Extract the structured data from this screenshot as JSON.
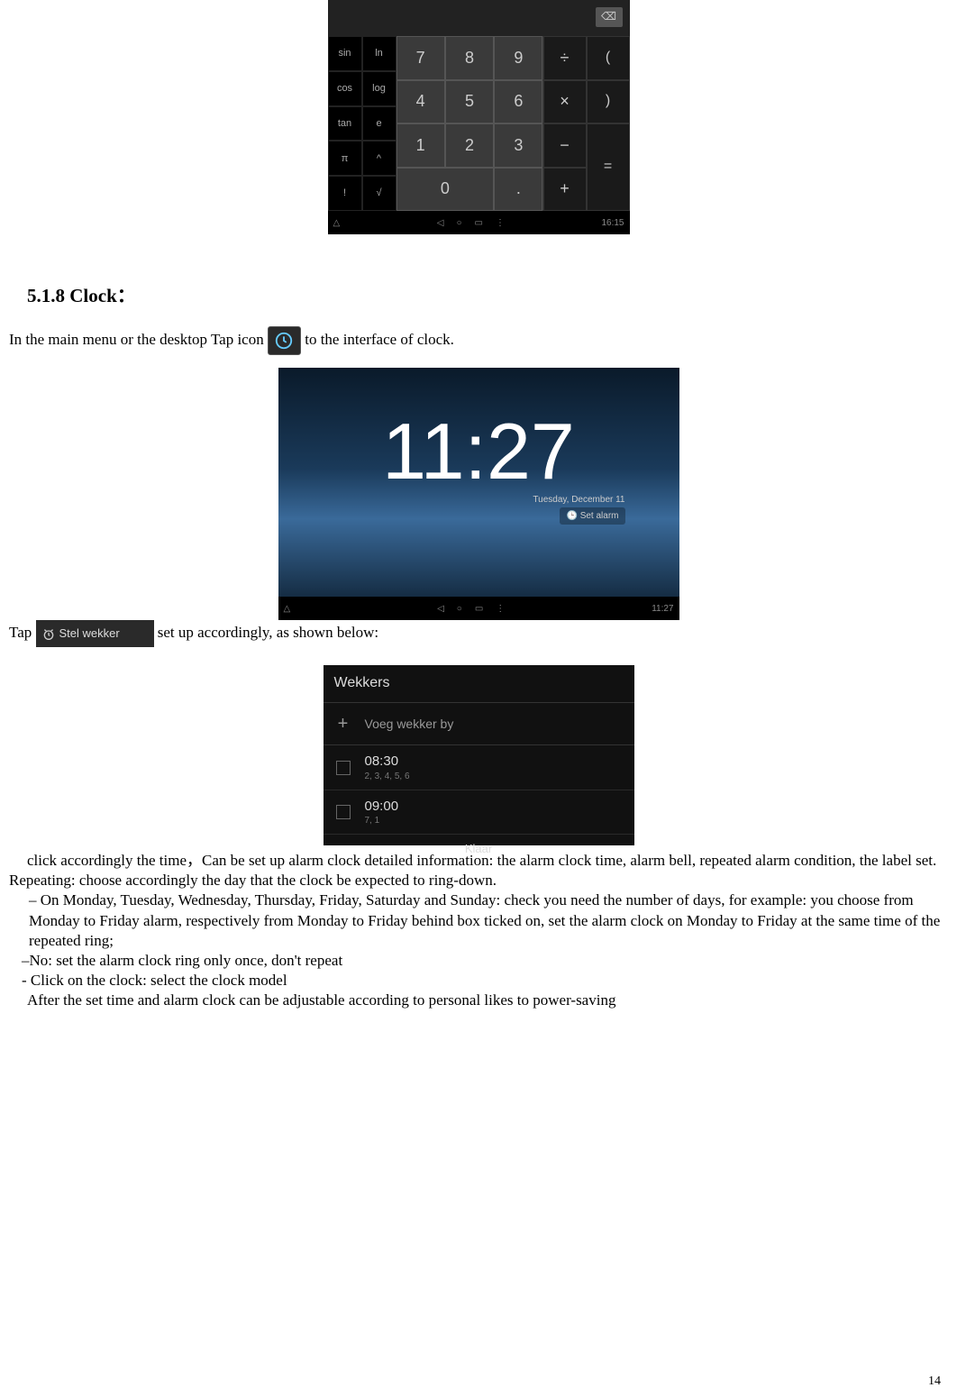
{
  "calculator": {
    "backspace": "⌫",
    "sci": [
      "sin",
      "ln",
      "cos",
      "log",
      "tan",
      "e",
      "π",
      "^",
      "!",
      "√"
    ],
    "nums": [
      "7",
      "8",
      "9",
      "4",
      "5",
      "6",
      "1",
      "2",
      "3",
      "0",
      "."
    ],
    "ops": [
      "÷",
      "×",
      "−",
      "+"
    ],
    "parens": [
      "(",
      ")",
      "="
    ],
    "nav_time": "16:15"
  },
  "heading": "5.1.8 Clock：",
  "intro": {
    "before": "In the main menu or the desktop Tap icon",
    "after": "to the interface of clock."
  },
  "clock": {
    "time": "11:27",
    "date": "Tuesday, December 11",
    "set_label": "Set alarm",
    "nav_time": "11:27"
  },
  "tap_line": {
    "before": "Tap",
    "btn": "Stel wekker",
    "after": "set up accordingly, as shown below:"
  },
  "wekkers": {
    "title": "Wekkers",
    "add": "Voeg wekker by",
    "rows": [
      {
        "time": "08:30",
        "days": "2, 3, 4, 5, 6"
      },
      {
        "time": "09:00",
        "days": "7, 1"
      }
    ],
    "done": "Klaar"
  },
  "body": {
    "l1": "click accordingly the time，Can be set up alarm clock detailed information: the alarm clock time, alarm bell, repeated alarm condition, the label set.",
    "l2": "Repeating: choose accordingly the day that the clock be expected to ring-down.",
    "l3": "– On Monday, Tuesday, Wednesday, Thursday, Friday, Saturday and Sunday: check you need the number of days, for example: you choose from Monday to Friday alarm, respectively from Monday to Friday behind box ticked on, set the alarm clock on Monday to Friday at the same time of the repeated ring;",
    "l4": "–No: set the alarm clock ring only once, don't repeat",
    "l5": "- Click on the clock: select the clock model",
    "l6": "After the set time and alarm clock can be adjustable according to personal likes to power-saving"
  },
  "page_number": "14"
}
